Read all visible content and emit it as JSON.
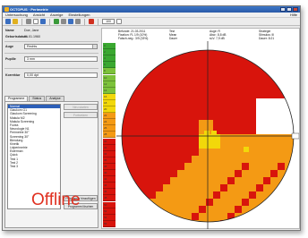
{
  "window": {
    "title": "OCTOPUS · Perimetrie",
    "menu": [
      "Untersuchung",
      "Ansicht",
      "Anzeige",
      "Einstellungen"
    ],
    "menu_right": "Hilfe",
    "zoom_value": "100"
  },
  "patient": {
    "name_label": "Name",
    "name_value": "Doe, Jane",
    "dob_label": "Geburtsdatum",
    "dob_value": "01.01.1960",
    "eye_label": "Auge",
    "eye_value": "Rechts",
    "pupil_label": "Pupille",
    "pupil_value": "3 mm",
    "correction_label": "Korrektur",
    "correction_value": "0,00 dpt"
  },
  "tabs": [
    "Programme",
    "Status",
    "Analyse"
  ],
  "programs": [
    "Normal",
    "Glaukom G1",
    "Glaukom Screening",
    "Makula M2",
    "Makula Screening",
    "Fovea",
    "Neurologie N1",
    "Perimetrie 30°",
    "Screening 30°",
    "Blendung",
    "Kinetik",
    "Lidperimetrie",
    "Esterman",
    "Quick",
    "Test 1",
    "Test 2",
    "Test 3"
  ],
  "program_selected_index": 0,
  "side_buttons": {
    "new_exam": "Neu starten",
    "continue_exam": "Fortsetzen",
    "add_program": "Programm hinzufügen",
    "delete_program": "Programm löschen"
  },
  "offline_label": "Offline",
  "exam_info": {
    "col1": [
      "Befunde: 21.03.2011",
      "Fixation: FL 1/9 (10%)",
      "Falsch-neg.: 3/9 (33%)"
    ],
    "col2": [
      "Test",
      "Mean",
      "Dauer"
    ],
    "col3": [
      "Auge: R",
      "Abw.: 8,8 dB",
      "sLV: 7,9 dB"
    ],
    "col4": [
      "Strategie",
      "Stimulus: III",
      "Dauer: 8:21"
    ]
  },
  "grayscale_legend": [
    "0",
    "2",
    "4",
    "6",
    "8",
    "10",
    "12",
    "14",
    "16",
    "18",
    "20",
    "22",
    "24",
    "26",
    "28",
    "30",
    "32",
    "34",
    "36",
    "38",
    "40",
    "42",
    "44",
    "46",
    "48",
    "50",
    "52",
    "54",
    "56"
  ],
  "colors": {
    "accent": "#2c5fb8",
    "offline": "#e03020",
    "red": "#d8140c",
    "orange": "#f49a14",
    "yellow": "#f2d80a",
    "green": "#3aa830",
    "white": "#ffffff"
  }
}
